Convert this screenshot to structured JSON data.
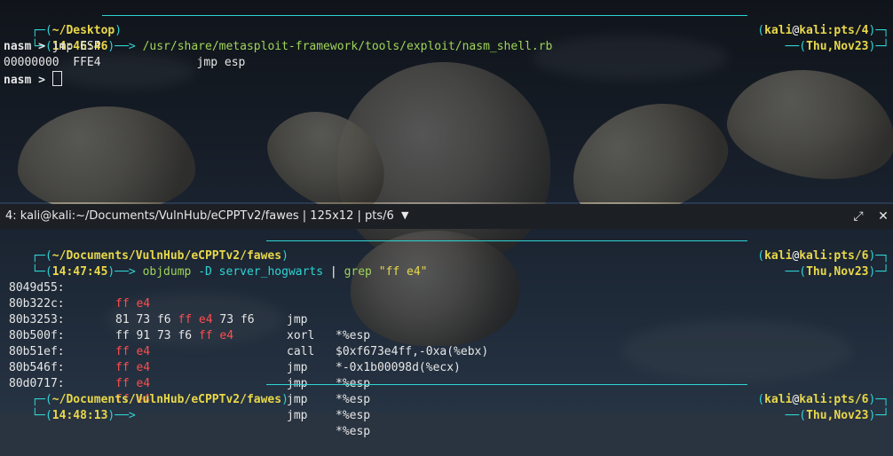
{
  "top_pane": {
    "cwd": "~/Desktop",
    "user": "kali",
    "at": "@",
    "host_tty": "kali:pts/4",
    "time": "14:46:46",
    "command": "/usr/share/metasploit-framework/tools/exploit/nasm_shell.rb",
    "date": "Thu,Nov23",
    "nasm_prompt": "nasm > ",
    "nasm_input_1": "jmp ESP",
    "output_offset": "00000000",
    "output_bytes": "FFE4",
    "output_asm": "jmp esp",
    "nasm_prompt_2": "nasm > "
  },
  "titlebar": {
    "title": "4: kali@kali:~/Documents/VulnHub/eCPPTv2/fawes | 125x12 | pts/6",
    "dropdown_icon": "caret-down-icon",
    "maximize_icon": "maximize-icon",
    "close_icon": "close-icon"
  },
  "bottom_pane": {
    "cwd": "~/Documents/VulnHub/eCPPTv2/fawes",
    "user": "kali",
    "at": "@",
    "host_tty": "kali:pts/6",
    "time": "14:47:45",
    "cmd_part1": "objdump",
    "cmd_flag": "-D",
    "cmd_file": "server_hogwarts",
    "cmd_pipe": "|",
    "cmd_grep": "grep",
    "cmd_pattern": "\"ff e4\"",
    "date": "Thu,Nov23",
    "rows": [
      {
        "addr": "8049d55:",
        "pre": "",
        "hit": "ff e4",
        "post": "",
        "mnemonic": "jmp",
        "operand": "*%esp"
      },
      {
        "addr": "80b322c:",
        "pre": "81 73 f6 ",
        "hit": "ff e4",
        "post": " 73 f6",
        "mnemonic": "xorl",
        "operand": "$0xf673e4ff,-0xa(%ebx)"
      },
      {
        "addr": "80b3253:",
        "pre": "ff 91 73 f6 ",
        "hit": "ff e4",
        "post": "",
        "mnemonic": "call",
        "operand": "*-0x1b00098d(%ecx)"
      },
      {
        "addr": "80b500f:",
        "pre": "",
        "hit": "ff e4",
        "post": "",
        "mnemonic": "jmp",
        "operand": "*%esp"
      },
      {
        "addr": "80b51ef:",
        "pre": "",
        "hit": "ff e4",
        "post": "",
        "mnemonic": "jmp",
        "operand": "*%esp"
      },
      {
        "addr": "80b546f:",
        "pre": "",
        "hit": "ff e4",
        "post": "",
        "mnemonic": "jmp",
        "operand": "*%esp"
      },
      {
        "addr": "80d0717:",
        "pre": "",
        "hit": "ff e4",
        "post": "",
        "mnemonic": "jmp",
        "operand": "*%esp"
      }
    ],
    "next_cwd": "~/Documents/VulnHub/eCPPTv2/fawes",
    "next_host_tty": "kali:pts/6",
    "next_time": "14:48:13",
    "next_date": "Thu,Nov23"
  },
  "colors": {
    "accent_cyan": "#2fd4d4",
    "prompt_yellow": "#e8d84a",
    "match_red": "#ff4d4d",
    "command_green": "#9fd45a"
  }
}
